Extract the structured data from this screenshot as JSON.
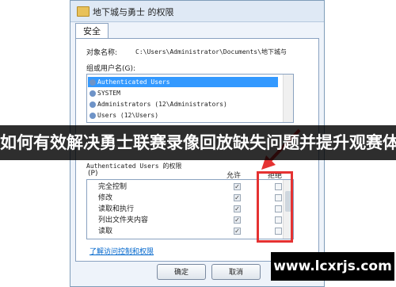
{
  "window": {
    "title": "地下城与勇士 的权限"
  },
  "tabs": [
    {
      "label": "安全"
    }
  ],
  "object": {
    "label": "对象名称:",
    "value": "C:\\Users\\Administrator\\Documents\\地下城与"
  },
  "groups": {
    "label": "组或用户名(G):",
    "items": [
      {
        "name": "Authenticated Users",
        "selected": true
      },
      {
        "name": "SYSTEM",
        "selected": false
      },
      {
        "name": "Administrators (12\\Administrators)",
        "selected": false
      },
      {
        "name": "Users (12\\Users)",
        "selected": false
      }
    ]
  },
  "permissions": {
    "label_line1": "Authenticated Users 的权限",
    "label_line2": "(P)",
    "allow_header": "允许",
    "deny_header": "拒绝",
    "rows": [
      {
        "name": "完全控制",
        "allow": true,
        "deny": false
      },
      {
        "name": "修改",
        "allow": true,
        "deny": false
      },
      {
        "name": "读取和执行",
        "allow": true,
        "deny": false
      },
      {
        "name": "列出文件夹内容",
        "allow": true,
        "deny": false
      },
      {
        "name": "读取",
        "allow": true,
        "deny": false
      }
    ]
  },
  "link": {
    "text": "了解访问控制和权限"
  },
  "buttons": {
    "ok": "确定",
    "cancel": "取消"
  },
  "overlay": {
    "banner_text": "如何有效解决勇士联赛录像回放缺失问题并提升观赛体验",
    "watermark": "www.lcxrjs.com"
  },
  "colors": {
    "highlight_box": "#e53232",
    "selection": "#3399ff",
    "link": "#0066cc"
  }
}
